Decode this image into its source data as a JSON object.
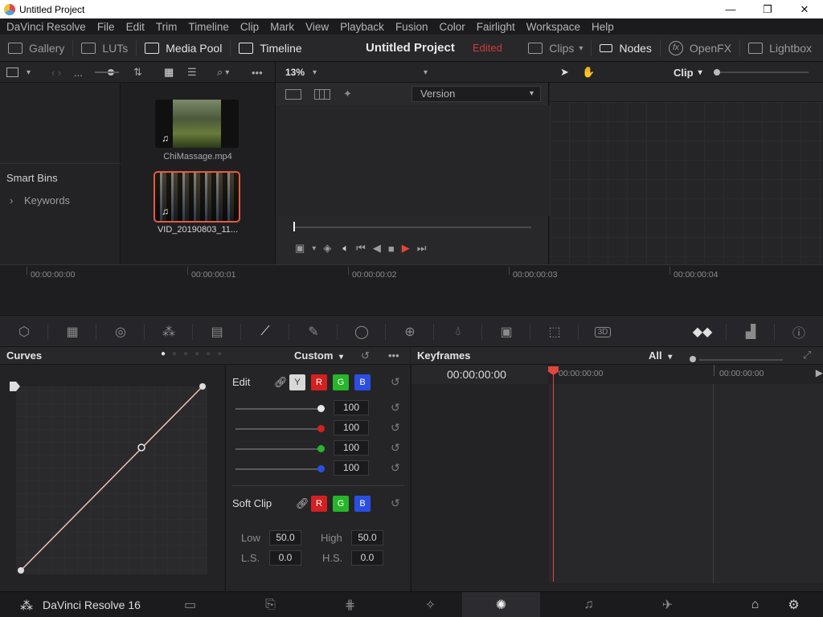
{
  "window": {
    "title": "Untitled Project",
    "controls": {
      "minimize": "—",
      "maximize": "❐",
      "close": "✕"
    }
  },
  "menu": [
    "DaVinci Resolve",
    "File",
    "Edit",
    "Trim",
    "Timeline",
    "Clip",
    "Mark",
    "View",
    "Playback",
    "Fusion",
    "Color",
    "Fairlight",
    "Workspace",
    "Help"
  ],
  "toolbar": {
    "gallery": "Gallery",
    "luts": "LUTs",
    "media_pool": "Media Pool",
    "timeline": "Timeline",
    "project_title": "Untitled Project",
    "edited": "Edited",
    "clips": "Clips",
    "nodes": "Nodes",
    "openfx": "OpenFX",
    "lightbox": "Lightbox"
  },
  "subbar": {
    "path": "...",
    "zoom": "13%",
    "clip_label": "Clip"
  },
  "media": {
    "smart_bins": "Smart Bins",
    "keywords": "Keywords",
    "clips": [
      {
        "name": "ChiMassage.mp4",
        "selected": false
      },
      {
        "name": "VID_20190803_11...",
        "selected": true
      }
    ]
  },
  "viewer": {
    "version_label": "Version"
  },
  "timeline": {
    "timecodes": [
      "00:00:00:00",
      "00:00:00:01",
      "00:00:00:02",
      "00:00:00:03",
      "00:00:00:04"
    ]
  },
  "curves": {
    "title": "Curves",
    "mode": "Custom"
  },
  "edit": {
    "label": "Edit",
    "channels": [
      "Y",
      "R",
      "G",
      "B"
    ],
    "intensity": [
      {
        "value": "100",
        "color": "#e6e6e6"
      },
      {
        "value": "100",
        "color": "#d42020"
      },
      {
        "value": "100",
        "color": "#27b52a"
      },
      {
        "value": "100",
        "color": "#2a4fe0"
      }
    ],
    "soft_clip_label": "Soft Clip",
    "soft_channels": [
      "R",
      "G",
      "B"
    ],
    "low_label": "Low",
    "low_value": "50.0",
    "high_label": "High",
    "high_value": "50.0",
    "ls_label": "L.S.",
    "ls_value": "0.0",
    "hs_label": "H.S.",
    "hs_value": "0.0"
  },
  "keyframes": {
    "title": "Keyframes",
    "filter": "All",
    "current_tc": "00:00:00:00",
    "ruler": [
      "00:00:00:00",
      "00:00:00:00"
    ]
  },
  "footer": {
    "app_name": "DaVinci Resolve 16"
  },
  "colors": {
    "accent_red": "#e55a3a",
    "edited_red": "#cf3a3a",
    "playhead": "#e0463a",
    "curve_line": "#f2c0b0"
  }
}
